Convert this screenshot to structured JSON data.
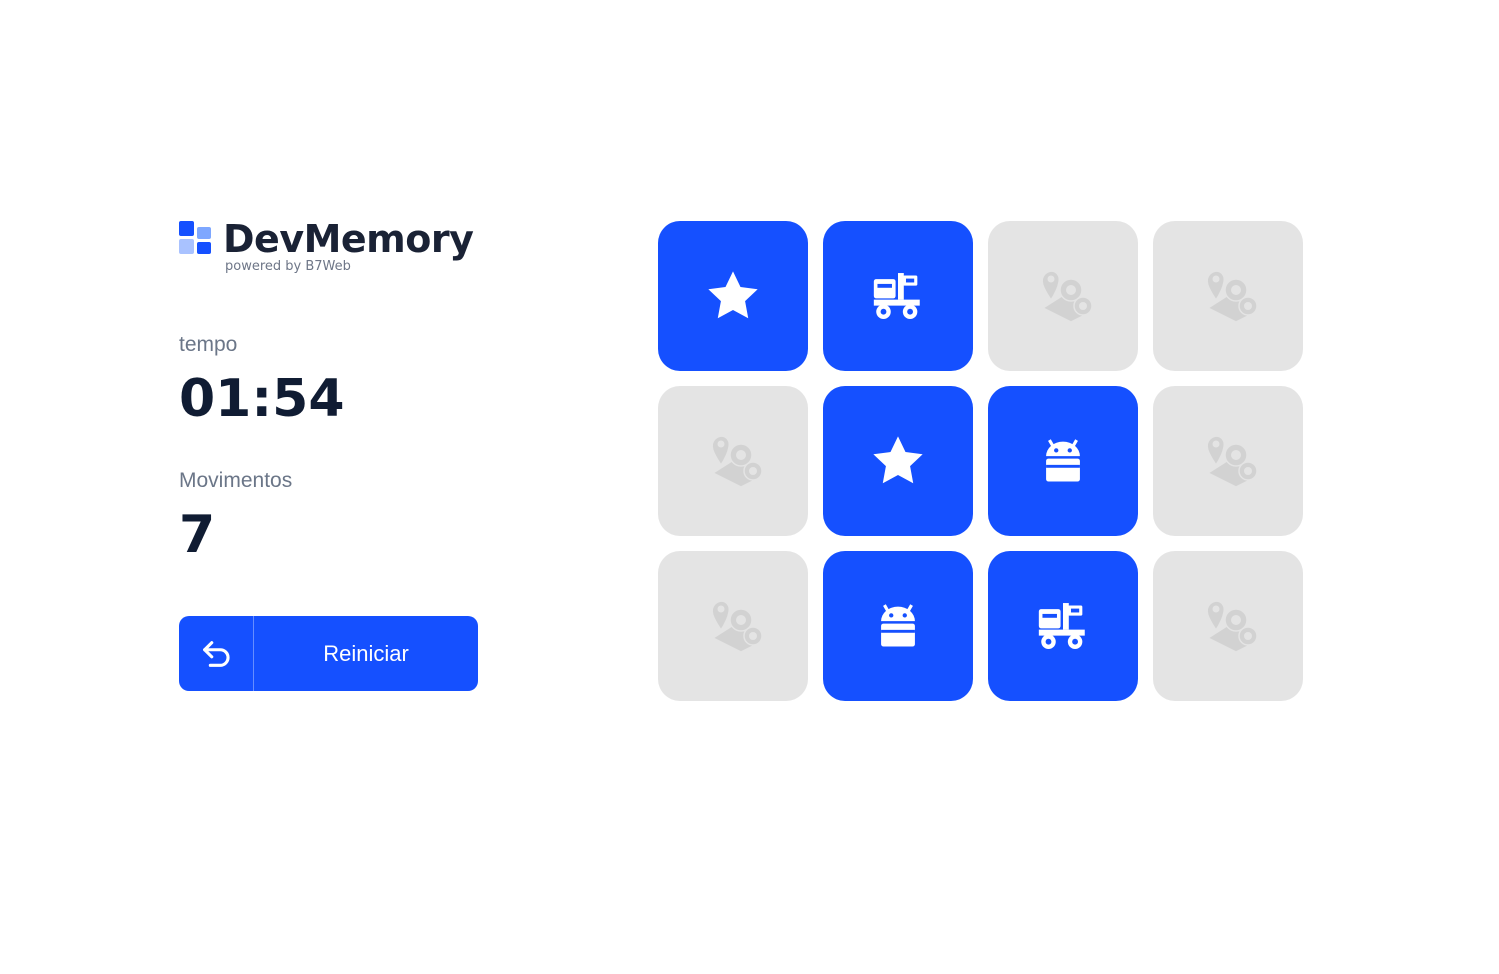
{
  "app": {
    "logo_name": "DevMemory",
    "logo_subtitle": "powered by B7Web"
  },
  "stats": {
    "time_label": "tempo",
    "time_value": "01:54",
    "moves_label": "Movimentos",
    "moves_value": "7"
  },
  "restart_button": {
    "label": "Reiniciar",
    "icon": "restart-icon"
  },
  "colors": {
    "accent": "#1550ff",
    "card_closed": "#e4e4e4",
    "text_dark": "#101c33",
    "text_muted": "#6b7688"
  },
  "board": {
    "rows": 3,
    "columns": 4,
    "cards": [
      {
        "state": "open",
        "icon": "star-icon"
      },
      {
        "state": "open",
        "icon": "truck-icon"
      },
      {
        "state": "closed",
        "icon": "placeholder-icon"
      },
      {
        "state": "closed",
        "icon": "placeholder-icon"
      },
      {
        "state": "closed",
        "icon": "placeholder-icon"
      },
      {
        "state": "open",
        "icon": "star-icon"
      },
      {
        "state": "open",
        "icon": "android-icon"
      },
      {
        "state": "closed",
        "icon": "placeholder-icon"
      },
      {
        "state": "closed",
        "icon": "placeholder-icon"
      },
      {
        "state": "open",
        "icon": "android-icon"
      },
      {
        "state": "open",
        "icon": "truck-icon"
      },
      {
        "state": "closed",
        "icon": "placeholder-icon"
      }
    ]
  }
}
